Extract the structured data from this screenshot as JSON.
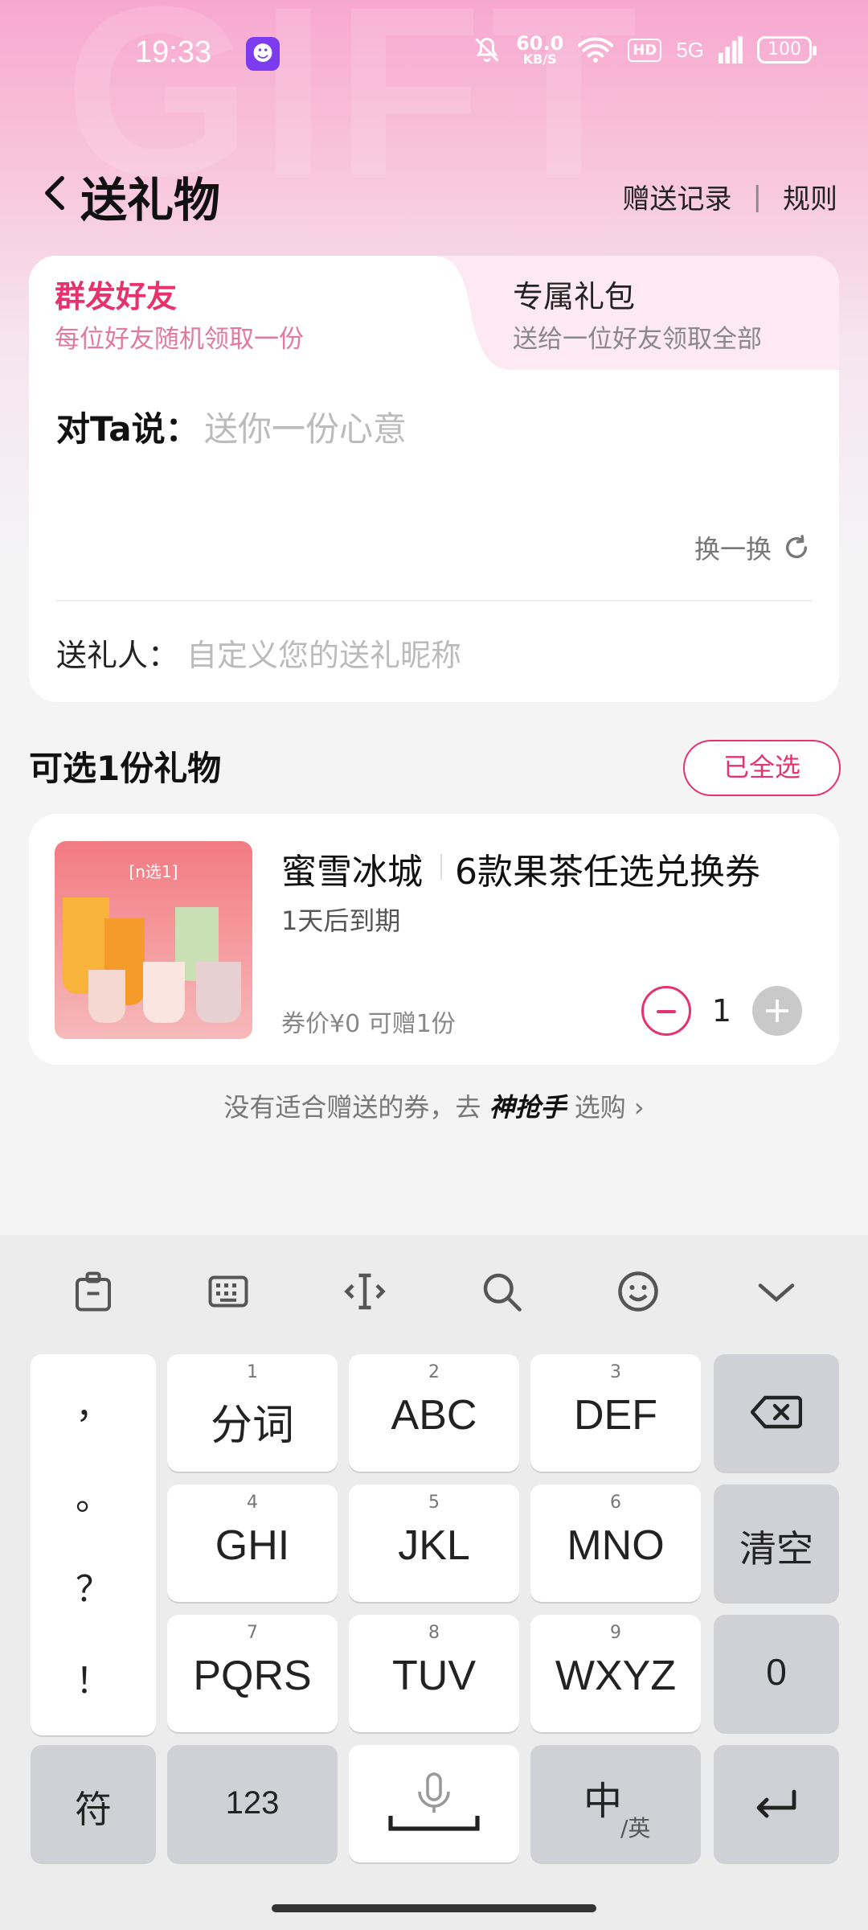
{
  "status_bar": {
    "time": "19:33",
    "net_speed": "60.0",
    "net_unit": "KB/S",
    "hd": "HD",
    "signal": "5G",
    "battery": "100"
  },
  "header": {
    "title": "送礼物",
    "record_link": "赠送记录",
    "separator": "|",
    "rules_link": "规则"
  },
  "tabs": [
    {
      "title": "群发好友",
      "subtitle": "每位好友随机领取一份"
    },
    {
      "title": "专属礼包",
      "subtitle": "送给一位好友领取全部"
    }
  ],
  "message": {
    "label": "对Ta说：",
    "placeholder": "送你一份心意",
    "refresh_label": "换一换"
  },
  "sender": {
    "label": "送礼人：",
    "placeholder": "自定义您的送礼昵称"
  },
  "gifts_section": {
    "title": "可选1份礼物",
    "select_all": "已全选"
  },
  "product": {
    "image_tag": "[n选1]",
    "brand": "蜜雪冰城",
    "name": "6款果茶任选兑换券",
    "expire": "1天后到期",
    "price_text": "券价¥0  可赠1份",
    "quantity": "1"
  },
  "footer_hint": {
    "prefix": "没有适合赠送的券，去",
    "brand": "神抢手",
    "suffix": "选购 ›"
  },
  "keyboard": {
    "punctuation": [
      "，",
      "。",
      "？",
      "！"
    ],
    "keys": [
      {
        "num": "1",
        "label": "分词"
      },
      {
        "num": "2",
        "label": "ABC"
      },
      {
        "num": "3",
        "label": "DEF"
      },
      {
        "num": "4",
        "label": "GHI"
      },
      {
        "num": "5",
        "label": "JKL"
      },
      {
        "num": "6",
        "label": "MNO"
      },
      {
        "num": "7",
        "label": "PQRS"
      },
      {
        "num": "8",
        "label": "TUV"
      },
      {
        "num": "9",
        "label": "WXYZ"
      }
    ],
    "clear": "清空",
    "zero": "0",
    "symbols": "符",
    "numbers": "123",
    "lang_main": "中",
    "lang_sub": "/英"
  },
  "colors": {
    "accent": "#e6336e",
    "hero_top": "#f7a8cf",
    "keyboard_bg": "#ececed"
  }
}
